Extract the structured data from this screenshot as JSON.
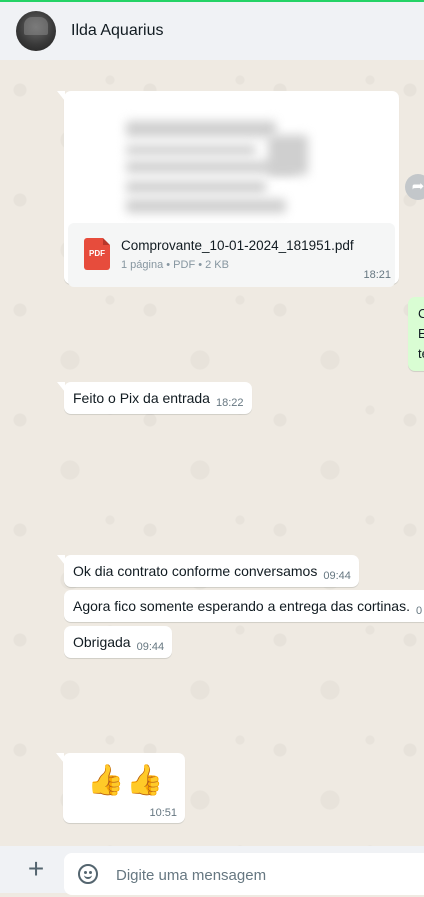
{
  "header": {
    "contact_name": "Ilda Aquarius",
    "avatar_icon": "profile-photo"
  },
  "messages": {
    "document": {
      "file_name": "Comprovante_10-01-2024_181951.pdf",
      "file_meta": "1 página • PDF • 2 KB",
      "file_type_label": "PDF",
      "time": "18:21",
      "forward_icon": "forward-icon"
    },
    "outgoing_partial": {
      "lines": [
        "C",
        "E",
        "te"
      ]
    },
    "pix": {
      "text": "Feito o Pix da entrada",
      "time": "18:22"
    },
    "contrato": {
      "text": "Ok dia contrato conforme conversamos",
      "time": "09:44"
    },
    "cortinas": {
      "text": "Agora fico somente esperando a entrega das cortinas.",
      "time": "0"
    },
    "obrigada": {
      "text": "Obrigada",
      "time": "09:44"
    },
    "thumbs": {
      "text": "👍👍",
      "time": "10:51"
    }
  },
  "footer": {
    "attach_icon": "plus-icon",
    "emoji_icon": "emoji-icon",
    "input_placeholder": "Digite uma mensagem",
    "input_value": ""
  },
  "colors": {
    "accent": "#25d366",
    "outgoing_bubble": "#d9fdd3",
    "incoming_bubble": "#ffffff",
    "chat_background": "#efeae2",
    "pdf_red": "#e74c3c"
  }
}
